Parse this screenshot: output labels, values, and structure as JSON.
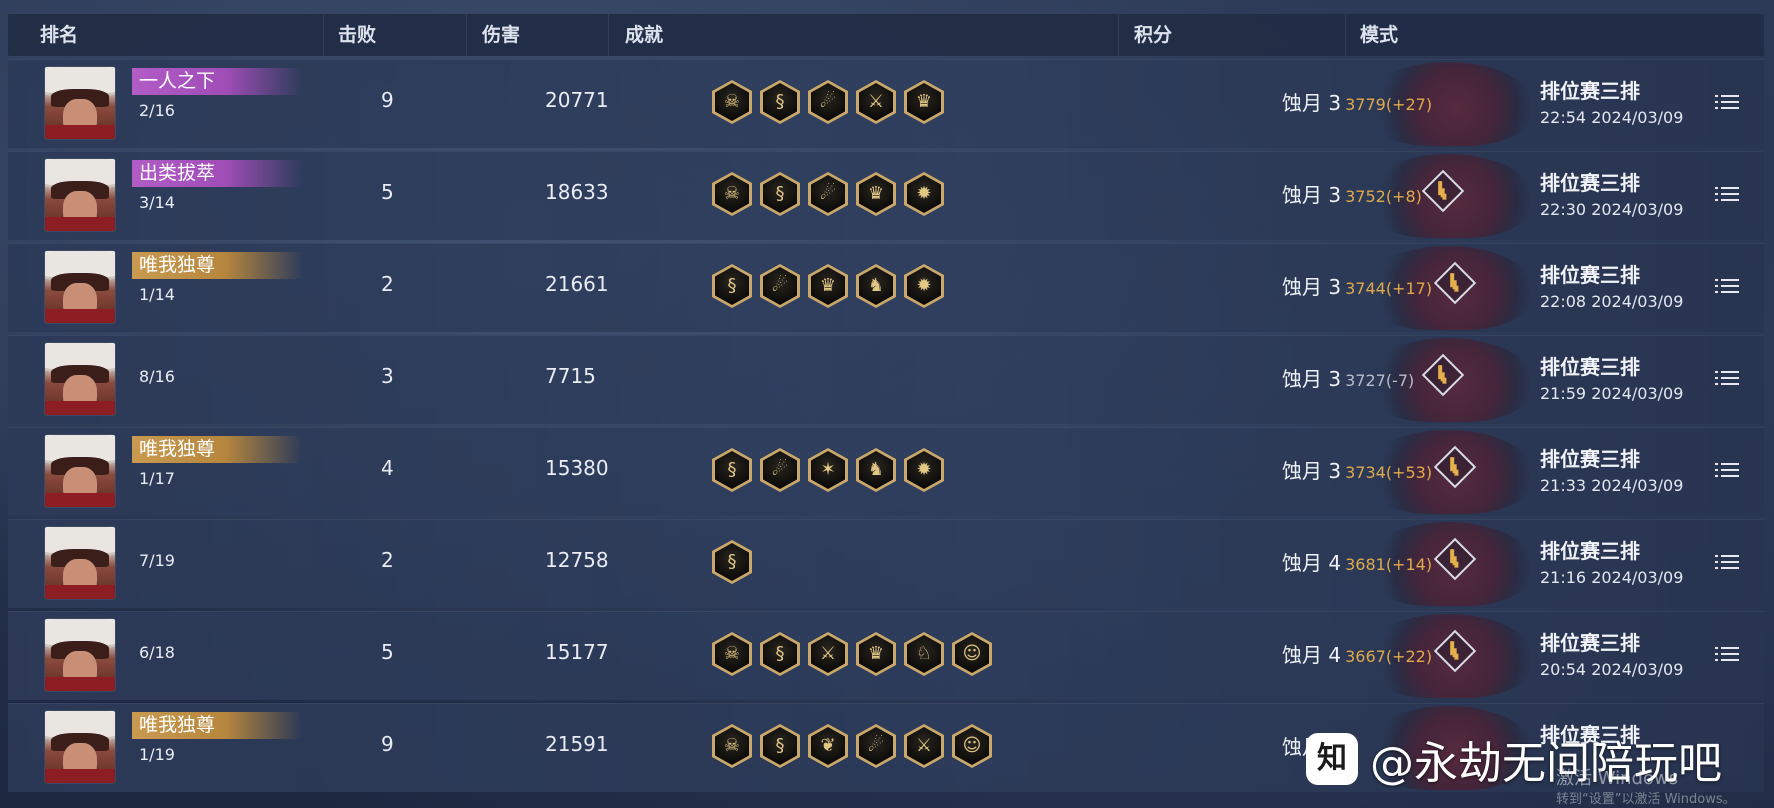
{
  "header": {
    "rank": "排名",
    "kills": "击败",
    "damage": "伤害",
    "achievements": "成就",
    "score": "积分",
    "mode": "模式"
  },
  "rows": [
    {
      "title": "一人之下",
      "title_color": "purple",
      "rank": "2/16",
      "kills": "9",
      "damage": "20771",
      "achievements": [
        "demon-mask-icon",
        "dragon-icon",
        "swirl-icon",
        "sword-crest-icon",
        "warrior-icon"
      ],
      "tier": "蚀月 3",
      "points": "3779(+27)",
      "trend": false,
      "mode": "排位赛三排",
      "time": "22:54  2024/03/09"
    },
    {
      "title": "出类拔萃",
      "title_color": "purple",
      "rank": "3/14",
      "kills": "5",
      "damage": "18633",
      "achievements": [
        "demon-mask-icon",
        "dragon-icon",
        "swirl-icon",
        "warrior-icon",
        "sun-icon"
      ],
      "tier": "蚀月 3",
      "points": "3752(+8)",
      "trend": true,
      "mode": "排位赛三排",
      "time": "22:30  2024/03/09"
    },
    {
      "title": "唯我独尊",
      "title_color": "gold",
      "rank": "1/14",
      "kills": "2",
      "damage": "21661",
      "achievements": [
        "dragon-icon",
        "swirl-icon",
        "warrior-icon",
        "kneeling-figure-icon",
        "sun-icon"
      ],
      "tier": "蚀月 3",
      "points": "3744(+17)",
      "trend": true,
      "mode": "排位赛三排",
      "time": "22:08  2024/03/09"
    },
    {
      "title": "",
      "title_color": "",
      "rank": "8/16",
      "kills": "3",
      "damage": "7715",
      "achievements": [],
      "tier": "蚀月 3",
      "points": "3727(-7)",
      "trend": true,
      "mode": "排位赛三排",
      "time": "21:59  2024/03/09"
    },
    {
      "title": "唯我独尊",
      "title_color": "gold",
      "rank": "1/17",
      "kills": "4",
      "damage": "15380",
      "achievements": [
        "dragon-icon",
        "swirl-icon",
        "crossed-blades-icon",
        "kneeling-figure-icon",
        "sun-icon"
      ],
      "tier": "蚀月 3",
      "points": "3734(+53)",
      "trend": true,
      "mode": "排位赛三排",
      "time": "21:33  2024/03/09"
    },
    {
      "title": "",
      "title_color": "",
      "rank": "7/19",
      "kills": "2",
      "damage": "12758",
      "achievements": [
        "dragon-icon"
      ],
      "tier": "蚀月 4",
      "points": "3681(+14)",
      "trend": true,
      "mode": "排位赛三排",
      "time": "21:16  2024/03/09"
    },
    {
      "title": "",
      "title_color": "",
      "rank": "6/18",
      "kills": "5",
      "damage": "15177",
      "achievements": [
        "demon-mask-icon",
        "dragon-icon",
        "sword-crest-icon",
        "warrior-icon",
        "horse-icon",
        "face-icon"
      ],
      "tier": "蚀月 4",
      "points": "3667(+22)",
      "trend": true,
      "mode": "排位赛三排",
      "time": "20:54  2024/03/09"
    },
    {
      "title": "唯我独尊",
      "title_color": "gold",
      "rank": "1/19",
      "kills": "9",
      "damage": "21591",
      "achievements": [
        "demon-mask-icon",
        "dragon-icon",
        "phoenix-icon",
        "swirl-icon",
        "sword-crest-icon",
        "face-icon"
      ],
      "tier": "蚀月",
      "points": "",
      "trend": false,
      "mode": "排位赛三排",
      "time": ""
    }
  ],
  "icons": {
    "demon-mask-icon": "☠",
    "dragon-icon": "§",
    "swirl-icon": "☄",
    "sword-crest-icon": "⚔",
    "warrior-icon": "♛",
    "sun-icon": "✹",
    "kneeling-figure-icon": "♞",
    "crossed-blades-icon": "✶",
    "horse-icon": "♘",
    "face-icon": "☺",
    "phoenix-icon": "❦"
  },
  "colors": {
    "points_positive": "#e0a94a",
    "points_negative": "#b6bccb",
    "badge_purple": "#b25cc6",
    "badge_gold": "#c99a50"
  },
  "watermark": {
    "logo": "知",
    "text": "@永劫无间陪玩吧"
  },
  "activation": {
    "line1": "激活 Windows",
    "line2": "转到“设置”以激活 Windows。"
  }
}
